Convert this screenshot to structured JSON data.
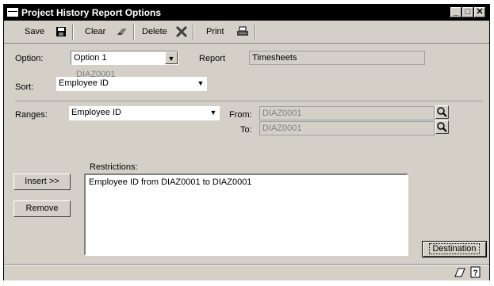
{
  "window": {
    "title": "Project History Report Options"
  },
  "window_controls": {
    "minimize": "_",
    "maximize": "□",
    "close": "✕"
  },
  "toolbar": {
    "save_label": "Save",
    "clear_label": "Clear",
    "delete_label": "Delete",
    "print_label": "Print"
  },
  "form": {
    "option_label": "Option:",
    "option_value": "Option 1",
    "report_label": "Report",
    "report_value": "Timesheets",
    "sort_label": "Sort:",
    "sort_value": "Employee ID",
    "sort_ghost_text": "DIAZ0001",
    "ranges_label": "Ranges:",
    "ranges_value": "Employee ID",
    "from_label": "From:",
    "from_value": "DIAZ0001",
    "to_label": "To:",
    "to_value": "DIAZ0001",
    "restrictions_label": "Restrictions:",
    "restrictions": [
      "Employee ID from DIAZ0001 to DIAZ0001"
    ]
  },
  "buttons": {
    "insert_label": "Insert >>",
    "remove_label": "Remove",
    "destination_label": "Destination"
  }
}
